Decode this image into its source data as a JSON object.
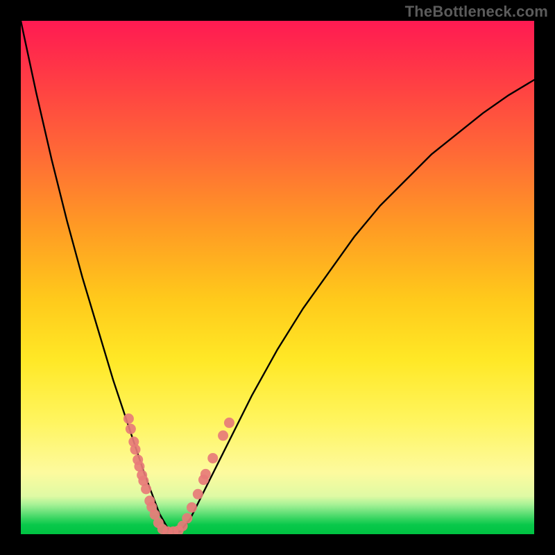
{
  "watermark": "TheBottleneck.com",
  "colors": {
    "frame": "#000000",
    "gradient_top": "#ff1a52",
    "gradient_mid": "#ffe826",
    "gradient_bottom": "#00c342",
    "curve": "#000000",
    "marker": "#e77b78"
  },
  "chart_data": {
    "type": "line",
    "title": "",
    "xlabel": "",
    "ylabel": "",
    "xlim": [
      0,
      100
    ],
    "ylim": [
      0,
      100
    ],
    "note": "x and y are in percent of the inner plot area (0,0 = bottom-left of colored square). Curve traces a V-shaped bottleneck profile with a flat zero minimum around x≈27–31.",
    "series": [
      {
        "name": "bottleneck-curve",
        "x": [
          0,
          3,
          6,
          9,
          12,
          15,
          18,
          21,
          24,
          27,
          29,
          31,
          33,
          36,
          40,
          45,
          50,
          55,
          60,
          65,
          70,
          75,
          80,
          85,
          90,
          95,
          100
        ],
        "y": [
          100,
          86,
          73,
          61,
          50,
          40,
          30,
          21,
          12,
          4,
          0.5,
          0.5,
          3,
          9,
          17,
          27,
          36,
          44,
          51,
          58,
          64,
          69,
          74,
          78,
          82,
          85.5,
          88.5
        ]
      }
    ],
    "markers": {
      "name": "highlighted-points",
      "note": "salmon dots clustered on both inner walls near the valley",
      "points": [
        {
          "x": 21.0,
          "y": 22.5
        },
        {
          "x": 21.4,
          "y": 20.5
        },
        {
          "x": 22.0,
          "y": 18.0
        },
        {
          "x": 22.3,
          "y": 16.5
        },
        {
          "x": 22.8,
          "y": 14.5
        },
        {
          "x": 23.1,
          "y": 13.2
        },
        {
          "x": 23.6,
          "y": 11.5
        },
        {
          "x": 23.9,
          "y": 10.4
        },
        {
          "x": 24.4,
          "y": 8.8
        },
        {
          "x": 25.1,
          "y": 6.5
        },
        {
          "x": 25.5,
          "y": 5.3
        },
        {
          "x": 26.1,
          "y": 3.8
        },
        {
          "x": 26.8,
          "y": 2.2
        },
        {
          "x": 27.6,
          "y": 1.0
        },
        {
          "x": 28.6,
          "y": 0.5
        },
        {
          "x": 29.7,
          "y": 0.5
        },
        {
          "x": 30.7,
          "y": 0.7
        },
        {
          "x": 31.5,
          "y": 1.6
        },
        {
          "x": 32.4,
          "y": 3.1
        },
        {
          "x": 33.3,
          "y": 5.2
        },
        {
          "x": 34.5,
          "y": 7.8
        },
        {
          "x": 35.6,
          "y": 10.6
        },
        {
          "x": 36.0,
          "y": 11.7
        },
        {
          "x": 37.4,
          "y": 14.8
        },
        {
          "x": 39.4,
          "y": 19.2
        },
        {
          "x": 40.6,
          "y": 21.7
        }
      ]
    }
  }
}
